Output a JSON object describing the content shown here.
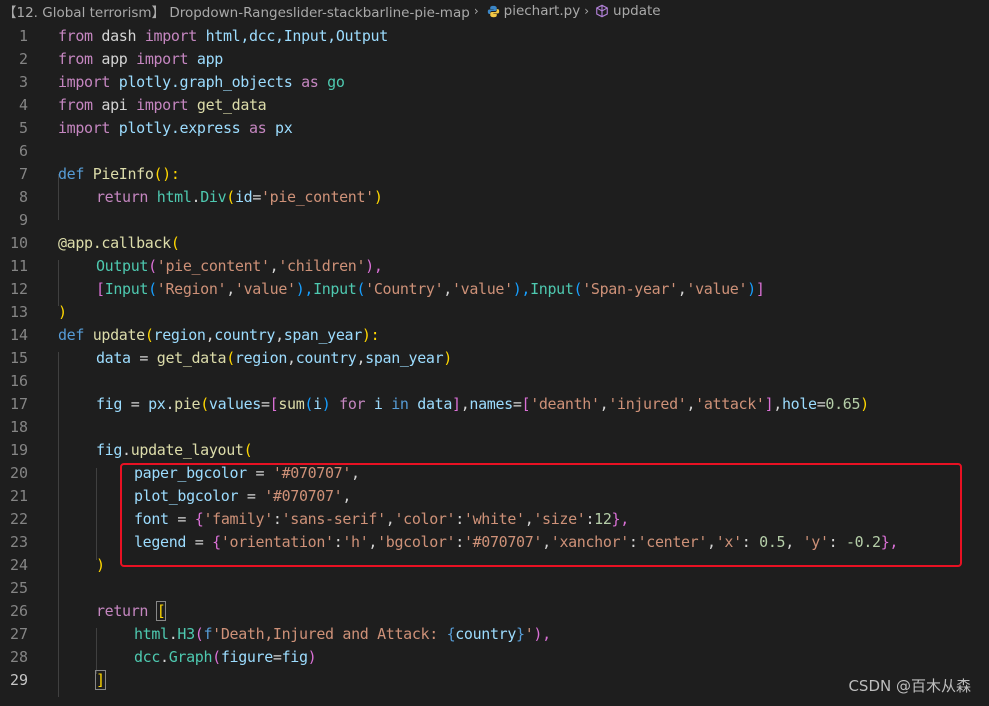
{
  "breadcrumb": {
    "folder": "【12. Global terrorism】 Dropdown-Rangeslider-stackbarline-pie-map",
    "file": "piechart.py",
    "symbol": "update",
    "file_icon": "python-icon",
    "symbol_icon": "method-cube-icon"
  },
  "line_numbers": [
    "1",
    "2",
    "3",
    "4",
    "5",
    "6",
    "7",
    "8",
    "9",
    "10",
    "11",
    "12",
    "13",
    "14",
    "15",
    "16",
    "17",
    "18",
    "19",
    "20",
    "21",
    "22",
    "23",
    "24",
    "25",
    "26",
    "27",
    "28",
    "29"
  ],
  "code": {
    "l1": [
      "from",
      " dash ",
      "import",
      " html,dcc,Input,Output"
    ],
    "l2": [
      "from",
      " app ",
      "import",
      " app"
    ],
    "l3": [
      "import",
      " plotly.graph_objects ",
      "as",
      " go"
    ],
    "l4": [
      "from",
      " api ",
      "import",
      " get_data"
    ],
    "l5": [
      "import",
      " plotly.express ",
      "as",
      " px"
    ],
    "l7": [
      "def",
      " ",
      "PieInfo",
      "():"
    ],
    "l8": [
      "return",
      " ",
      "html",
      ".",
      "Div",
      "(",
      "id",
      "=",
      "'pie_content'",
      ")"
    ],
    "l10": [
      "@app.callback",
      "("
    ],
    "l11": [
      "Output",
      "(",
      "'pie_content'",
      ",",
      "'children'",
      "),"
    ],
    "l12": [
      "[",
      "Input",
      "(",
      "'Region'",
      ",",
      "'value'",
      "),",
      "Input",
      "(",
      "'Country'",
      ",",
      "'value'",
      "),",
      "Input",
      "(",
      "'Span-year'",
      ",",
      "'value'",
      ")",
      "]"
    ],
    "l13": [
      ")"
    ],
    "l14": [
      "def",
      " ",
      "update",
      "(",
      "region",
      ",",
      "country",
      ",",
      "span_year",
      "):"
    ],
    "l15": [
      "data",
      " = ",
      "get_data",
      "(",
      "region",
      ",",
      "country",
      ",",
      "span_year",
      ")"
    ],
    "l17": [
      "fig",
      " = ",
      "px",
      ".",
      "pie",
      "(",
      "values",
      "=",
      "[",
      "sum",
      "(",
      "i",
      ")",
      " for ",
      "i",
      " in ",
      "data",
      "]",
      ",",
      "names",
      "=",
      "[",
      "'deanth'",
      ",",
      "'injured'",
      ",",
      "'attack'",
      "]",
      ",",
      "hole",
      "=",
      "0.65",
      ")"
    ],
    "l19": [
      "fig",
      ".",
      "update_layout",
      "("
    ],
    "l20": [
      "paper_bgcolor",
      " = ",
      "'#070707'",
      ","
    ],
    "l21": [
      "plot_bgcolor",
      " = ",
      "'#070707'",
      ","
    ],
    "l22": [
      "font",
      " = ",
      "{",
      "'family'",
      ":",
      "'sans-serif'",
      ",",
      "'color'",
      ":",
      "'white'",
      ",",
      "'size'",
      ":",
      "12",
      "},"
    ],
    "l23": [
      "legend",
      " = ",
      "{",
      "'orientation'",
      ":",
      "'h'",
      ",",
      "'bgcolor'",
      ":",
      "'#070707'",
      ",",
      "'xanchor'",
      ":",
      "'center'",
      ",",
      "'x'",
      ": ",
      "0.5",
      ", ",
      "'y'",
      ": ",
      "-0.2",
      "},"
    ],
    "l24": [
      ")"
    ],
    "l26": [
      "return",
      " ",
      "["
    ],
    "l27": [
      "html",
      ".",
      "H3",
      "(",
      "f",
      "'Death,Injured and Attack: ",
      "{",
      "country",
      "}",
      "'",
      "),"
    ],
    "l28": [
      "dcc",
      ".",
      "Graph",
      "(",
      "figure",
      "=",
      "fig",
      ")"
    ],
    "l29": [
      "]"
    ]
  },
  "watermark": "CSDN @百木从森",
  "colors": {
    "background": "#1e1e1e",
    "highlight_border": "#e81123"
  }
}
